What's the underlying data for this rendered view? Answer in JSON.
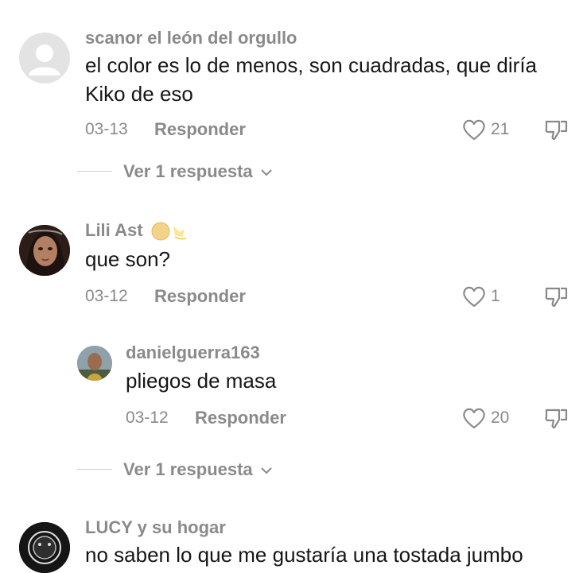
{
  "comments": [
    {
      "username": "scanor el león del orgullo",
      "text": "el color es lo de menos, son cuadradas, que diría Kiko de eso",
      "date": "03-13",
      "reply_label": "Responder",
      "likes": "21",
      "view_replies": "Ver 1 respuesta",
      "avatar": "default-avatar-icon"
    },
    {
      "username": "Lili Ast",
      "emoji": [
        "full-moon-icon",
        "dizzy-star-icon"
      ],
      "text": "que son?",
      "date": "03-12",
      "reply_label": "Responder",
      "likes": "1",
      "avatar": "profile-photo"
    },
    {
      "username": "danielguerra163",
      "text": "pliegos de masa",
      "date": "03-12",
      "reply_label": "Responder",
      "likes": "20",
      "view_replies": "Ver 1 respuesta",
      "avatar": "profile-photo",
      "is_reply": true
    },
    {
      "username": "LUCY y su hogar",
      "text": "no saben lo que me gustaría una tostada jumbo",
      "avatar": "profile-photo"
    }
  ],
  "colors": {
    "muted": "#8a8a8a",
    "text": "#161616",
    "divider": "#cfcfcf"
  }
}
